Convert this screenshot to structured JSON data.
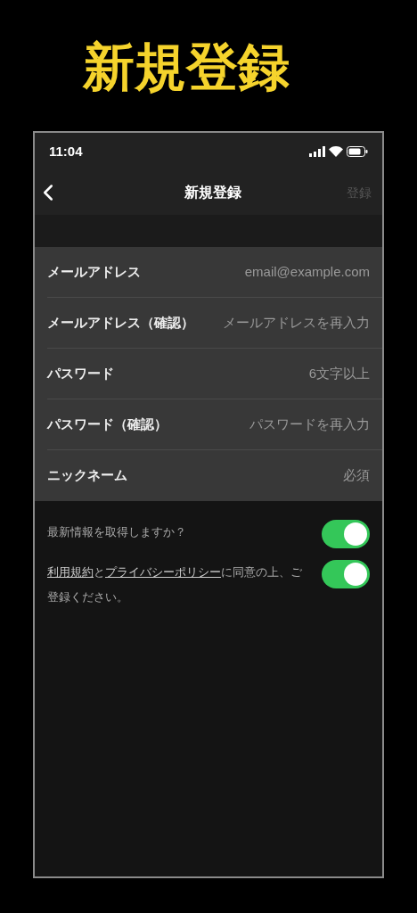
{
  "headline": "新規登録",
  "status_bar": {
    "time": "11:04"
  },
  "nav": {
    "title": "新規登録",
    "action": "登録",
    "action_disabled": true
  },
  "fields": [
    {
      "label": "メールアドレス",
      "placeholder": "email@example.com"
    },
    {
      "label": "メールアドレス（確認）",
      "placeholder": "メールアドレスを再入力"
    },
    {
      "label": "パスワード",
      "placeholder": "6文字以上"
    },
    {
      "label": "パスワード（確認）",
      "placeholder": "パスワードを再入力"
    },
    {
      "label": "ニックネーム",
      "placeholder": "必須"
    }
  ],
  "toggles": [
    {
      "parts": [
        {
          "kind": "text",
          "text": "最新情報を取得しますか？"
        }
      ],
      "on": true
    },
    {
      "parts": [
        {
          "kind": "link",
          "text": "利用規約"
        },
        {
          "kind": "text",
          "text": "と"
        },
        {
          "kind": "link",
          "text": "プライバシーポリシー"
        },
        {
          "kind": "text",
          "text": "に同意の上、ご登録ください。"
        }
      ],
      "on": true
    }
  ]
}
